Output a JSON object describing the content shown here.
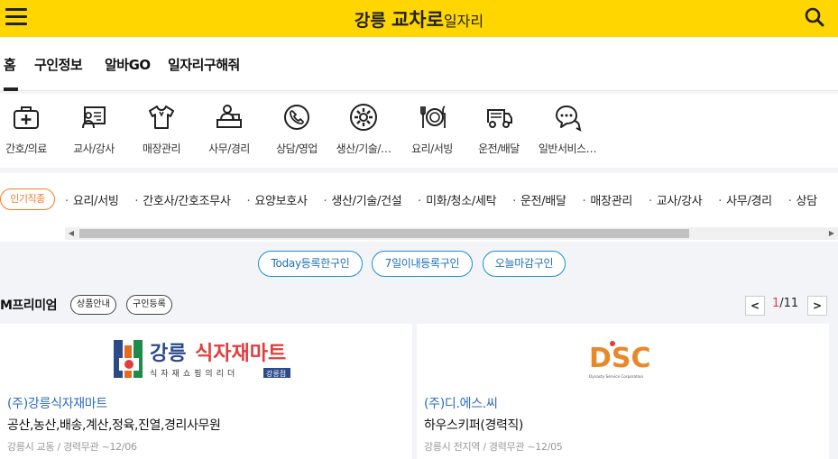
{
  "header": {
    "logo_prefix": "강릉",
    "logo_main": "교차로",
    "logo_suffix": "일자리",
    "menu_icon": "hamburger-icon",
    "search_icon": "search-icon",
    "bg_color": "#ffd600"
  },
  "tabs": [
    {
      "label": "홈",
      "active": true
    },
    {
      "label": "구인정보"
    },
    {
      "label": "알바GO"
    },
    {
      "label": "일자리구해줘"
    }
  ],
  "categories": [
    {
      "label": "간호/의료",
      "icon": "medical-kit-icon"
    },
    {
      "label": "교사/강사",
      "icon": "teacher-board-icon"
    },
    {
      "label": "매장관리",
      "icon": "shirt-icon"
    },
    {
      "label": "사무/경리",
      "icon": "office-desk-icon"
    },
    {
      "label": "상담/영업",
      "icon": "phone-call-icon"
    },
    {
      "label": "생산/기술/…",
      "icon": "gear-icon"
    },
    {
      "label": "요리/서빙",
      "icon": "dining-icon"
    },
    {
      "label": "운전/배달",
      "icon": "truck-icon"
    },
    {
      "label": "일반서비스…",
      "icon": "chat-bubbles-icon"
    }
  ],
  "popular": {
    "badge": "인기직종",
    "items": [
      "요리/서빙",
      "간호사/간호조무사",
      "요양보호사",
      "생산/기술/건설",
      "미화/청소/세탁",
      "운전/배달",
      "매장관리",
      "교사/강사",
      "사무/경리",
      "상담"
    ]
  },
  "filters": [
    "Today등록한구인",
    "7일이내등록구인",
    "오늘마감구인"
  ],
  "premium": {
    "title": "M프리미엄",
    "btn_info": "상품안내",
    "btn_register": "구인등록",
    "page_current": "1",
    "page_total": "/11",
    "prev": "<",
    "next": ">"
  },
  "cards": [
    {
      "logo_text": "강릉식자재마트",
      "logo_text_pre": "강릉",
      "logo_text_main": "식자재마트",
      "logo_sub": "식자재쇼핑의리더",
      "logo_tag": "강릉점",
      "company": "(주)강릉식자재마트",
      "job": "공산,농산,배송,계산,정육,진열,경리사무원",
      "meta": "강릉시 교동 / 경력무관  ~12/06"
    },
    {
      "logo_text": "DSC",
      "logo_sub": "Dynasty Service Corporation",
      "company": "(주)디.에스.씨",
      "job": "하우스키퍼(경력직)",
      "meta": "강릉시 전지역 / 경력무관  ~12/05"
    }
  ],
  "colors": {
    "accent_yellow": "#ffd600",
    "link_blue": "#2a6bc2",
    "badge_orange": "#f27d2b",
    "pager_red": "#e83d3d"
  }
}
